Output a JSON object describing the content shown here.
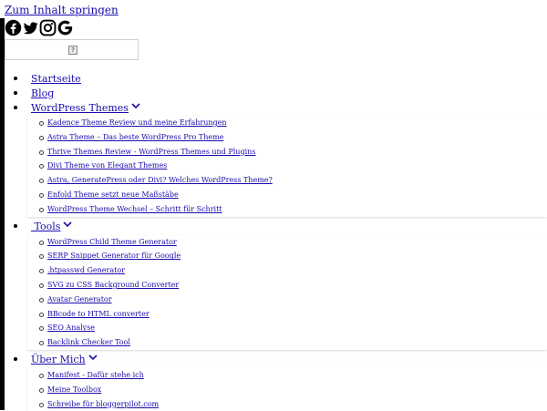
{
  "skip_link": "Zum Inhalt springen",
  "social": [
    "facebook-icon",
    "twitter-icon",
    "instagram-icon",
    "google-icon"
  ],
  "menu": [
    {
      "label": "Startseite"
    },
    {
      "label": "Blog"
    },
    {
      "label": "WordPress Themes",
      "children": [
        "Kadence Theme Review und meine Erfahrungen",
        "Astra Theme – Das beste WordPress Pro Theme",
        "Thrive Themes Review - WordPress Themes und Plugins",
        "Divi Theme von Elegant Themes",
        "Astra, GeneratePress oder Divi? Welches WordPress Theme?",
        "Enfold Theme setzt neue Maßstäbe",
        "WordPress Theme Wechsel – Schritt für Schritt"
      ]
    },
    {
      "label": " Tools",
      "children": [
        "WordPress Child Theme Generator",
        "SERP Snippet Generator für Google",
        ".htpasswd Generator",
        "SVG zu CSS Background Converter",
        "Avatar Generator",
        "BBcode to HTML converter",
        "SEO Analyse",
        "Backlink Checker Tool"
      ]
    },
    {
      "label": "Über Mich",
      "children": [
        "Manifest - Dafür stehe ich",
        "Meine Toolbox",
        "Schreibe für bloggerpilot.com"
      ]
    }
  ],
  "colors": {
    "link": "#1a0dab",
    "frame": "#000000",
    "icon": "#000000"
  }
}
